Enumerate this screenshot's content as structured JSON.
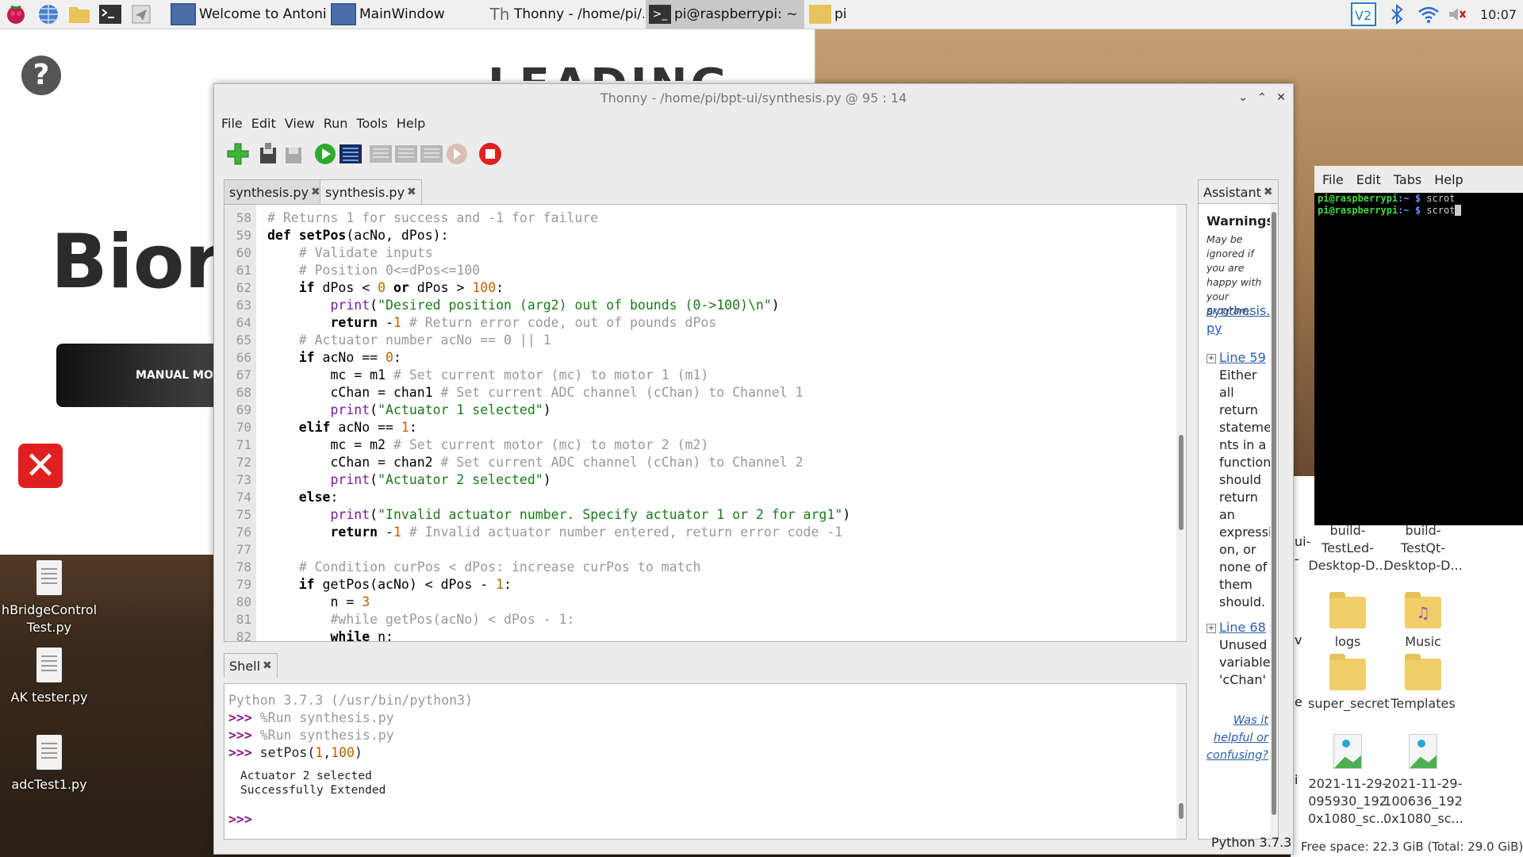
{
  "taskbar": {
    "tasks": [
      {
        "label": "Welcome to Antonio's..."
      },
      {
        "label": "MainWindow"
      },
      {
        "label": "Thonny  -  /home/pi/..."
      },
      {
        "label": "pi@raspberrypi: ~"
      },
      {
        "label": "pi"
      }
    ],
    "clock": "10:07"
  },
  "browser": {
    "logo_text": "LEADING EDGE",
    "heading": "Bior",
    "manual_mode_label": "MANUAL MOD"
  },
  "desktop": {
    "icons": [
      {
        "label": "hBridgeControl\nTest.py"
      },
      {
        "label": "AK tester.py"
      },
      {
        "label": "adcTest1.py"
      }
    ]
  },
  "filemanager": {
    "items": [
      {
        "label": "build-\nTestLed-\nDesktop-D..."
      },
      {
        "label": "build-\nTestQt-\nDesktop-D..."
      },
      {
        "label": "logs"
      },
      {
        "label": "Music"
      },
      {
        "label": "super_secret"
      },
      {
        "label": "Templates"
      },
      {
        "label": "2021-11-29-\n095930_192\n0x1080_sc..."
      },
      {
        "label": "2021-11-29-\n100636_192\n0x1080_sc..."
      }
    ],
    "partial_labels": [
      "ui-",
      "-",
      "v",
      "e",
      "i"
    ],
    "status": "Free space: 22.3 GiB (Total: 29.0 GiB)"
  },
  "terminal": {
    "menu": [
      "File",
      "Edit",
      "Tabs",
      "Help"
    ],
    "lines": [
      {
        "user": "pi@raspberrypi",
        "path": ":~ $",
        "cmd": " scrot"
      },
      {
        "user": "pi@raspberrypi",
        "path": ":~ $",
        "cmd": " scrot"
      }
    ]
  },
  "thonny": {
    "title": "Thonny  -  /home/pi/bpt-ui/synthesis.py  @  95 : 14",
    "menu": [
      "File",
      "Edit",
      "View",
      "Run",
      "Tools",
      "Help"
    ],
    "tabs": [
      "synthesis.py",
      "synthesis.py"
    ],
    "shell_tab": "Shell",
    "assistant_tab": "Assistant",
    "status_python": "Python 3.7.3",
    "shell": {
      "banner": "Python 3.7.3 (/usr/bin/python3)",
      "prompt": ">>>",
      "run1": "%Run synthesis.py",
      "run2": "%Run synthesis.py",
      "cmd_name": "setPos(",
      "cmd_arg1": "1",
      "cmd_comma": ",",
      "cmd_arg2": "100",
      "cmd_end": ")",
      "output1": "Actuator 2 selected",
      "output2": "Successfully Extended"
    },
    "assistant": {
      "warnings_title": "Warnings",
      "warnings_note": "May be ignored if you are happy with your program.",
      "file_link": "synthesis.\npy",
      "w1_link": "Line 59",
      "w1_text": "Either all return stateme nts in a function should return an expressi on, or none of them should.",
      "w2_link": "Line 68",
      "w2_text": "Unused variable 'cChan'",
      "feedback": "Was it helpful or confusing?"
    }
  },
  "code_lines": [
    58,
    59,
    60,
    61,
    62,
    63,
    64,
    65,
    66,
    67,
    68,
    69,
    70,
    71,
    72,
    73,
    74,
    75,
    76,
    77,
    78,
    79,
    80,
    81,
    82
  ]
}
